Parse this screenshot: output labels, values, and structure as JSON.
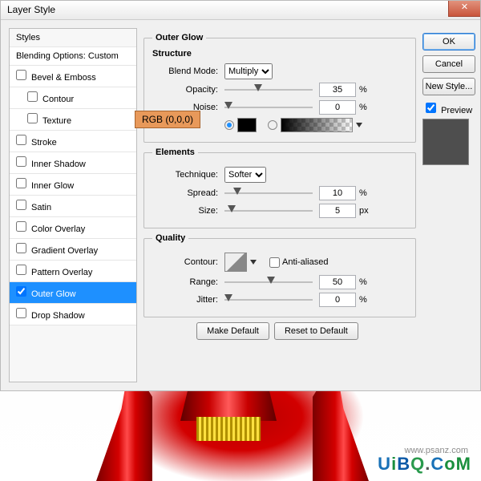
{
  "dialog": {
    "title": "Layer Style"
  },
  "styles": {
    "header": "Styles",
    "blending": "Blending Options: Custom",
    "items": [
      {
        "label": "Bevel & Emboss",
        "checked": false
      },
      {
        "label": "Contour",
        "checked": false
      },
      {
        "label": "Texture",
        "checked": false
      },
      {
        "label": "Stroke",
        "checked": false
      },
      {
        "label": "Inner Shadow",
        "checked": false
      },
      {
        "label": "Inner Glow",
        "checked": false
      },
      {
        "label": "Satin",
        "checked": false
      },
      {
        "label": "Color Overlay",
        "checked": false
      },
      {
        "label": "Gradient Overlay",
        "checked": false
      },
      {
        "label": "Pattern Overlay",
        "checked": false
      },
      {
        "label": "Outer Glow",
        "checked": true
      },
      {
        "label": "Drop Shadow",
        "checked": false
      }
    ]
  },
  "outer_glow": {
    "legend": "Outer Glow",
    "structure": {
      "title": "Structure",
      "blend_mode_label": "Blend Mode:",
      "blend_mode": "Multiply",
      "opacity_label": "Opacity:",
      "opacity": "35",
      "opacity_unit": "%",
      "noise_label": "Noise:",
      "noise": "0",
      "noise_unit": "%",
      "color_callout": "RGB (0,0,0)"
    },
    "elements": {
      "title": "Elements",
      "technique_label": "Technique:",
      "technique": "Softer",
      "spread_label": "Spread:",
      "spread": "10",
      "spread_unit": "%",
      "size_label": "Size:",
      "size": "5",
      "size_unit": "px"
    },
    "quality": {
      "title": "Quality",
      "contour_label": "Contour:",
      "anti_alias_label": "Anti-aliased",
      "range_label": "Range:",
      "range": "50",
      "range_unit": "%",
      "jitter_label": "Jitter:",
      "jitter": "0",
      "jitter_unit": "%"
    },
    "make_default": "Make Default",
    "reset_default": "Reset to Default"
  },
  "buttons": {
    "ok": "OK",
    "cancel": "Cancel",
    "new_style": "New Style...",
    "preview": "Preview"
  },
  "watermark": {
    "sub": "www.psanz.com",
    "main": "UiBQ.CoM"
  }
}
